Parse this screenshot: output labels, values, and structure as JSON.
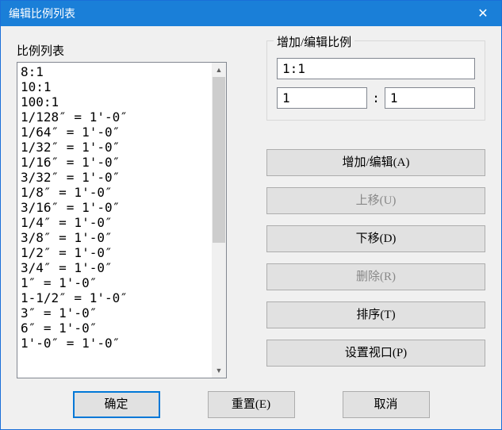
{
  "window": {
    "title": "编辑比例列表"
  },
  "left": {
    "label": "比例列表",
    "items": [
      "8:1",
      "10:1",
      "100:1",
      "1/128″ = 1'-0″",
      "1/64″ = 1'-0″",
      "1/32″ = 1'-0″",
      "1/16″ = 1'-0″",
      "3/32″ = 1'-0″",
      "1/8″ = 1'-0″",
      "3/16″ = 1'-0″",
      "1/4″ = 1'-0″",
      "3/8″ = 1'-0″",
      "1/2″ = 1'-0″",
      "3/4″ = 1'-0″",
      "1″ = 1'-0″",
      "1-1/2″ = 1'-0″",
      "3″ = 1'-0″",
      "6″ = 1'-0″",
      "1'-0″ = 1'-0″"
    ]
  },
  "right": {
    "group_label": "增加/编辑比例",
    "name_input": "1:1",
    "ratio_left": "1",
    "ratio_right": "1",
    "colon": ":",
    "buttons": {
      "add_edit": "增加/编辑(A)",
      "move_up": "上移(U)",
      "move_down": "下移(D)",
      "delete": "删除(R)",
      "sort": "排序(T)",
      "set_viewport": "设置视口(P)"
    }
  },
  "bottom": {
    "ok": "确定",
    "reset": "重置(E)",
    "cancel": "取消"
  }
}
